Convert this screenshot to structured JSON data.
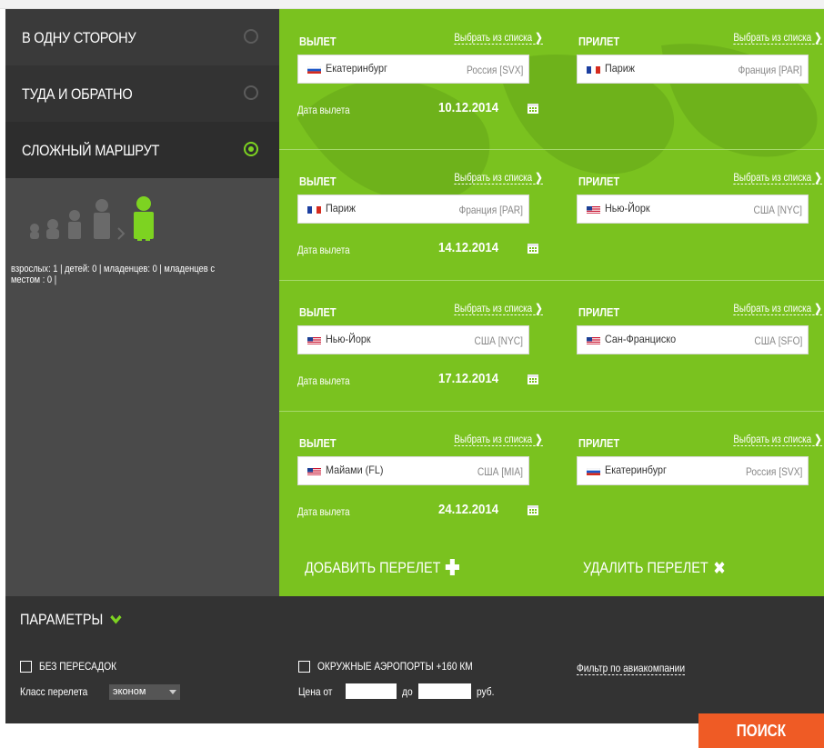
{
  "trip_types": [
    {
      "label": "В ОДНУ СТОРОНУ",
      "selected": false
    },
    {
      "label": "ТУДА И ОБРАТНО",
      "selected": false
    },
    {
      "label": "СЛОЖНЫЙ МАРШРУТ",
      "selected": true
    }
  ],
  "passengers": {
    "summary": "взрослых: 1 | детей: 0 | младенцев: 0 | младенцев с местом : 0 |"
  },
  "labels": {
    "departure": "ВЫЛЕТ",
    "arrival": "ПРИЛЕТ",
    "pick_from_list": "Выбрать из списка",
    "departure_date": "Дата вылета"
  },
  "segments": [
    {
      "from": {
        "city": "Екатеринбург",
        "country": "Россия [SVX]",
        "flag": "ru"
      },
      "to": {
        "city": "Париж",
        "country": "Франция [PAR]",
        "flag": "fr"
      },
      "date": "10.12.2014"
    },
    {
      "from": {
        "city": "Париж",
        "country": "Франция [PAR]",
        "flag": "fr"
      },
      "to": {
        "city": "Нью-Йорк",
        "country": "США [NYC]",
        "flag": "us"
      },
      "date": "14.12.2014"
    },
    {
      "from": {
        "city": "Нью-Йорк",
        "country": "США [NYC]",
        "flag": "us"
      },
      "to": {
        "city": "Сан-Франциско",
        "country": "США [SFO]",
        "flag": "us"
      },
      "date": "17.12.2014"
    },
    {
      "from": {
        "city": "Майами (FL)",
        "country": "США [MIA]",
        "flag": "us"
      },
      "to": {
        "city": "Екатеринбург",
        "country": "Россия [SVX]",
        "flag": "ru"
      },
      "date": "24.12.2014"
    }
  ],
  "actions": {
    "add_flight": "ДОБАВИТЬ ПЕРЕЛЕТ",
    "remove_flight": "УДАЛИТЬ ПЕРЕЛЕТ"
  },
  "params": {
    "title": "ПАРАМЕТРЫ",
    "nonstop": "БЕЗ ПЕРЕСАДОК",
    "nearby_airports": "ОКРУЖНЫЕ АЭРОПОРТЫ +160 КМ",
    "airline_filter": "Фильтр по авиакомпании",
    "class_label": "Класс перелета",
    "class_value": "эконом",
    "price_from": "Цена от",
    "price_to": "до",
    "currency": "руб."
  },
  "search_button": "ПОИСК",
  "colors": {
    "green": "#7ac21f",
    "accent_green": "#7dd321",
    "dark": "#333333",
    "orange": "#ef5b25"
  }
}
